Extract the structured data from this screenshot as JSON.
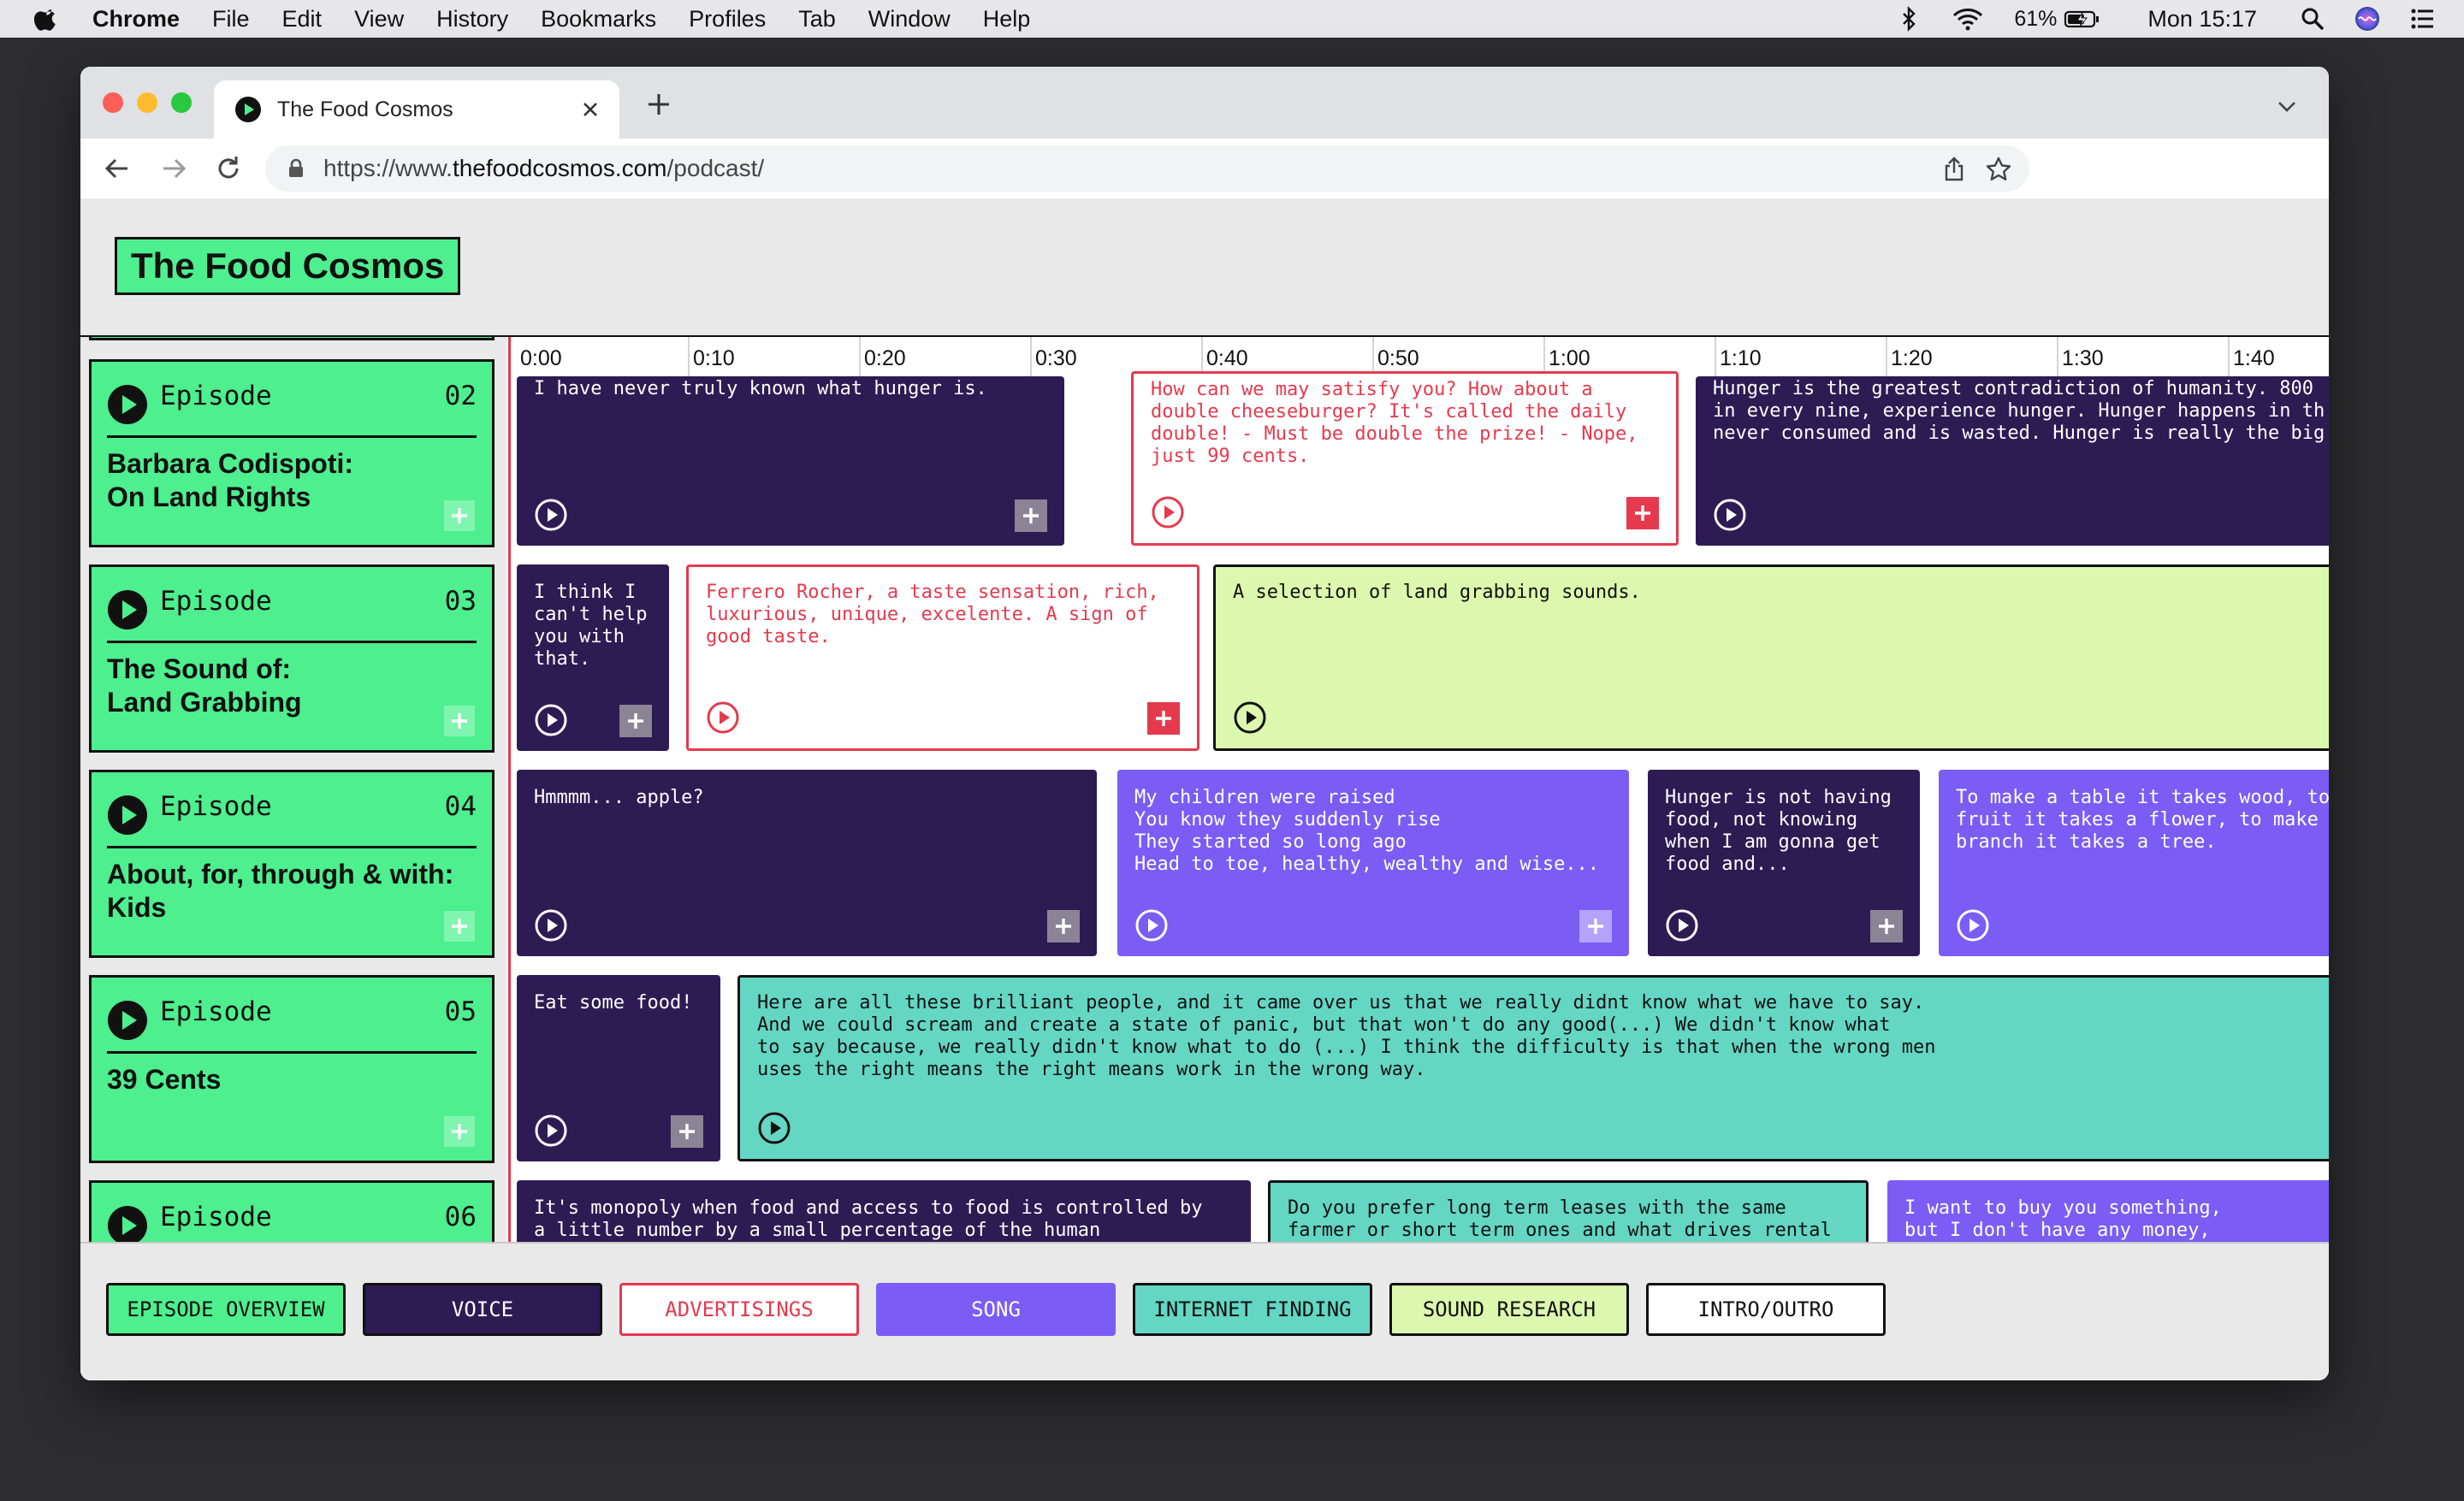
{
  "menubar": {
    "app": "Chrome",
    "items": [
      "File",
      "Edit",
      "View",
      "History",
      "Bookmarks",
      "Profiles",
      "Tab",
      "Window",
      "Help"
    ],
    "battery": "61%",
    "clock": "Mon 15:17"
  },
  "browser": {
    "tab_title": "The Food Cosmos",
    "url_prefix": "https://www.",
    "url_host": "thefoodcosmos.com",
    "url_path": "/podcast/"
  },
  "site": {
    "logo": "The Food Cosmos"
  },
  "episodes": [
    {
      "label": "Episode",
      "number": "02",
      "title": "Barbara Codispoti:\nOn Land Rights"
    },
    {
      "label": "Episode",
      "number": "03",
      "title": "The Sound of:\nLand Grabbing"
    },
    {
      "label": "Episode",
      "number": "04",
      "title": "About, for, through & with:\nKids"
    },
    {
      "label": "Episode",
      "number": "05",
      "title": "39 Cents"
    },
    {
      "label": "Episode",
      "number": "06",
      "title": ""
    }
  ],
  "timeline": {
    "ticks": [
      "0:00",
      "0:10",
      "0:20",
      "0:30",
      "0:40",
      "0:50",
      "1:00",
      "1:10",
      "1:20",
      "1:30",
      "1:40"
    ]
  },
  "clips": {
    "r0c0": "I have never truly known what hunger is.",
    "r0c1": "How can we may satisfy you? How about a\ndouble cheeseburger? It's called the daily\ndouble! - Must be double the prize! - Nope,\njust 99 cents.",
    "r0c2": "Hunger is the greatest contradiction of humanity. 800\nin every nine, experience hunger. Hunger happens in th\nnever consumed and is wasted. Hunger is really the big",
    "r1c0": "I think I\ncan't help\nyou with\nthat.",
    "r1c1": "Ferrero Rocher, a taste sensation, rich,\nluxurious, unique, excelente. A sign of\ngood taste.",
    "r1c2": "A selection of land grabbing sounds.",
    "r2c0": "Hmmmm... apple?",
    "r2c1": "My children were raised\nYou know they suddenly rise\nThey started so long ago\nHead to toe, healthy, wealthy and wise...",
    "r2c2": "Hunger is not having\nfood, not knowing\nwhen I am gonna get\nfood and...",
    "r2c3": "To make a table it takes wood, to\nfruit it takes a flower, to make\nbranch it takes a tree.",
    "r3c0": "Eat some food!",
    "r3c1": "Here are all these brilliant people, and it came over us that we really didnt know what we have to say.\nAnd we could scream and create a state of panic, but that won't do any good(...) We didn't know what\nto say because, we really didn't know what to do (...) I think the difficulty is that when the wrong men\nuses the right means the right means work in the wrong way.",
    "r4c0": "It's monopoly when food and access to food is controlled by\na little number by a small percentage of the human",
    "r4c1": "Do you prefer long term leases with the same\nfarmer or short term ones and what drives rental",
    "r4c2": "I want to buy you something,\nbut I don't have any money,"
  },
  "legend": [
    {
      "label": "EPISODE OVERVIEW",
      "color": "#4def8e"
    },
    {
      "label": "VOICE",
      "color": "#2d1b54"
    },
    {
      "label": "ADVERTISINGS",
      "color": "#ffffff"
    },
    {
      "label": "SONG",
      "color": "#7b5cf5"
    },
    {
      "label": "INTERNET FINDING",
      "color": "#64d6c4"
    },
    {
      "label": "SOUND RESEARCH",
      "color": "#dcf8ae"
    },
    {
      "label": "INTRO/OUTRO",
      "color": "#ffffff"
    }
  ],
  "icons": {
    "play": "play-circle-icon",
    "add": "plus-icon",
    "episode_play": "play-filled-circle-icon"
  }
}
